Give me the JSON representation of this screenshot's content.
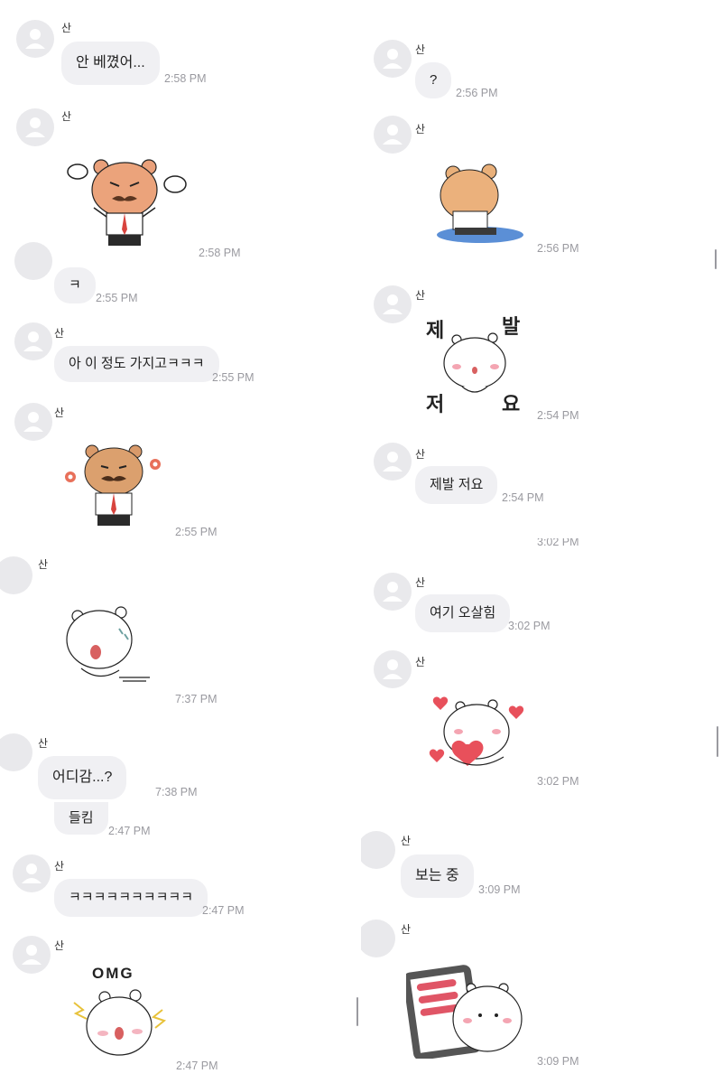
{
  "sender": "산",
  "left_messages": [
    {
      "text": "안 베꼈어...",
      "time": "2:58 PM"
    },
    {
      "sticker": "angry-bear-mustache-sticker",
      "time": "2:58 PM"
    },
    {
      "text": "ㅋ",
      "time": "2:55 PM"
    },
    {
      "text": "아 이 정도 가지고ㅋㅋㅋ",
      "time": "2:55 PM"
    },
    {
      "sticker": "bear-mustache-flowers-sticker",
      "time": "2:55 PM"
    },
    {
      "sticker": "shocked-hamster-sticker",
      "time": "7:37 PM"
    },
    {
      "text": "어디감...?",
      "time": "7:38 PM"
    },
    {
      "text": "들킴",
      "time": "2:47 PM"
    },
    {
      "text": "ㅋㅋㅋㅋㅋㅋㅋㅋㅋㅋ",
      "time": "2:47 PM"
    },
    {
      "sticker": "omg-hamster-sticker",
      "sticker_text": "OMG",
      "time": "2:47 PM"
    }
  ],
  "right_messages": [
    {
      "text": "?",
      "time": "2:56 PM"
    },
    {
      "sticker": "sad-bear-puddle-sticker",
      "time": "2:56 PM"
    },
    {
      "sticker": "please-hamster-sticker",
      "sticker_chars": [
        "제",
        "발",
        "저",
        "요"
      ],
      "time": "2:54 PM"
    },
    {
      "text": "제발 저요",
      "time": "2:54 PM"
    },
    {
      "time_fragment": "3:02 PM"
    },
    {
      "text": "여기 오살힘",
      "time": "3:02 PM"
    },
    {
      "sticker": "heart-hamster-sticker",
      "time": "3:02 PM"
    },
    {
      "text": "보는 중",
      "time": "3:09 PM"
    },
    {
      "sticker": "hamster-phone-sticker",
      "time": "3:09 PM"
    }
  ],
  "colors": {
    "bubble": "#f0f0f3",
    "avatar": "#e9e9ec",
    "timestamp": "#9a9aa0",
    "accent_red": "#e8505b"
  }
}
